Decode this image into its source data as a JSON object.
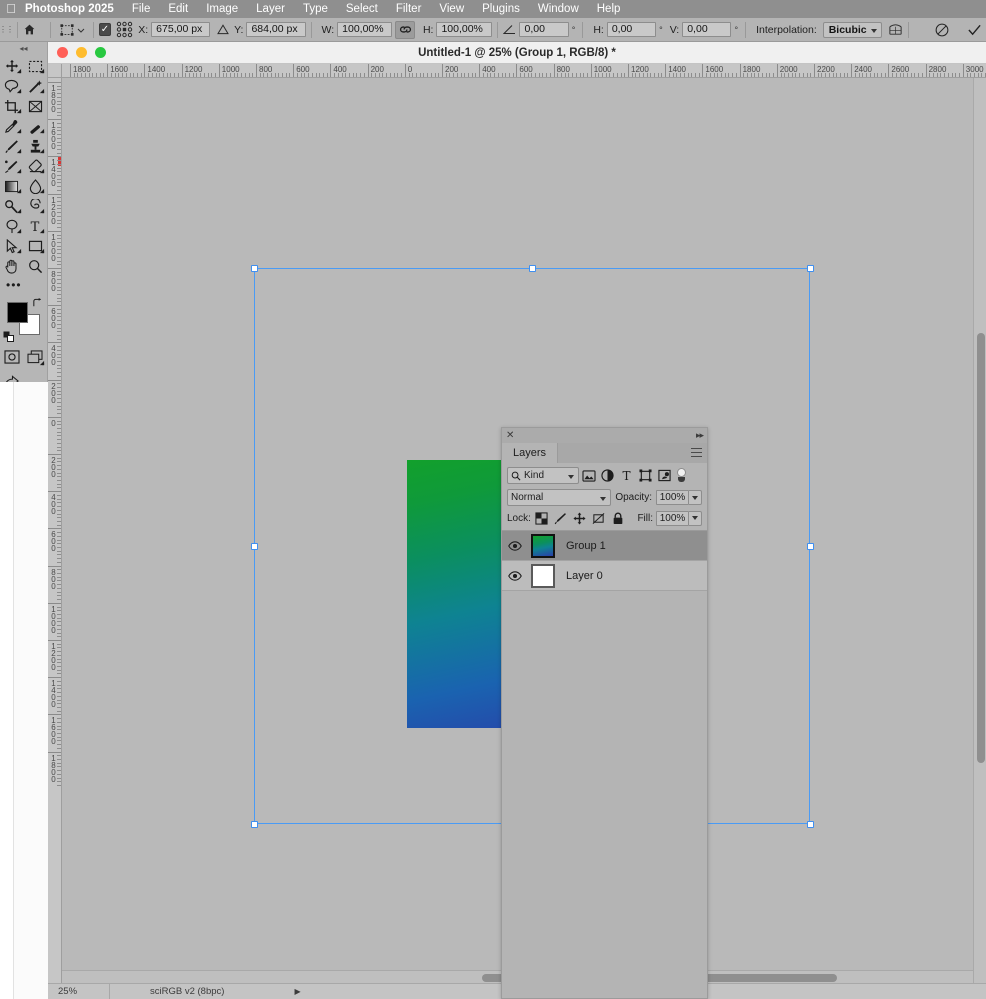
{
  "app": {
    "name": "Photoshop 2025",
    "menus": [
      "File",
      "Edit",
      "Image",
      "Layer",
      "Type",
      "Select",
      "Filter",
      "View",
      "Plugins",
      "Window",
      "Help"
    ]
  },
  "options_bar": {
    "home_icon": "home-icon",
    "tool_preset_icon": "transform-tool-icon",
    "reference_point_icon": "reference-point-grid-icon",
    "show_transform_checkbox": true,
    "x_label": "X:",
    "x_value": "675,00 px",
    "delta_icon": "delta-triangle-icon",
    "y_label": "Y:",
    "y_value": "684,00 px",
    "w_label": "W:",
    "w_value": "100,00%",
    "link_icon": "chain-link-icon",
    "h_label": "H:",
    "h_value": "100,00%",
    "angle_icon": "rotate-angle-icon",
    "angle_value": "0,00",
    "angle_unit": "°",
    "skew_h_label": "H:",
    "skew_h_value": "0,00",
    "skew_h_unit": "°",
    "skew_v_label": "V:",
    "skew_v_value": "0,00",
    "skew_v_unit": "°",
    "interpolation_label": "Interpolation:",
    "interpolation_value": "Bicubic",
    "warp_icon": "warp-mode-icon",
    "cancel_icon": "cancel-transform-icon",
    "commit_icon": "commit-transform-icon"
  },
  "tools": [
    {
      "name": "move-tool",
      "icon": "move-arrows-icon",
      "has_corner": true
    },
    {
      "name": "rectangular-marquee-tool",
      "icon": "marquee-dashed-rect-icon",
      "has_corner": true
    },
    {
      "name": "lasso-tool",
      "icon": "lasso-icon",
      "has_corner": true
    },
    {
      "name": "magic-wand-tool",
      "icon": "magic-wand-icon",
      "has_corner": true
    },
    {
      "name": "crop-tool",
      "icon": "crop-icon",
      "has_corner": true
    },
    {
      "name": "frame-tool",
      "icon": "frame-icon",
      "has_corner": false
    },
    {
      "name": "eyedropper-tool",
      "icon": "eyedropper-icon",
      "has_corner": true
    },
    {
      "name": "spot-healing-brush-tool",
      "icon": "healing-brush-icon",
      "has_corner": true
    },
    {
      "name": "brush-tool",
      "icon": "brush-icon",
      "has_corner": true
    },
    {
      "name": "clone-stamp-tool",
      "icon": "clone-stamp-icon",
      "has_corner": true
    },
    {
      "name": "history-brush-tool",
      "icon": "history-brush-icon",
      "has_corner": true
    },
    {
      "name": "eraser-tool",
      "icon": "eraser-icon",
      "has_corner": true
    },
    {
      "name": "gradient-tool",
      "icon": "gradient-icon",
      "has_corner": true
    },
    {
      "name": "blur-tool",
      "icon": "blur-droplet-icon",
      "has_corner": true
    },
    {
      "name": "dodge-tool",
      "icon": "dodge-icon",
      "has_corner": true
    },
    {
      "name": "pen-tool",
      "icon": "pen-icon",
      "has_corner": true
    },
    {
      "name": "path-selection-tool",
      "icon": "path-select-arrow-icon",
      "has_corner": true
    },
    {
      "name": "type-tool",
      "icon": "type-t-icon",
      "has_corner": true
    },
    {
      "name": "rectangle-tool",
      "icon": "rectangle-shape-icon",
      "has_corner": true
    },
    {
      "name": "hand-tool",
      "icon": "hand-icon",
      "has_corner": false
    },
    {
      "name": "zoom-tool",
      "icon": "magnifier-icon",
      "has_corner": false
    }
  ],
  "tools_more": {
    "name": "edit-toolbar-more",
    "icon": "ellipsis-icon",
    "label": "•••"
  },
  "color_swatches": {
    "foreground": "#000000",
    "background": "#ffffff",
    "swap_icon": "swap-colors-icon",
    "default_icon": "default-colors-icon"
  },
  "tools_bottom": [
    {
      "name": "quick-mask-toggle",
      "icon": "quick-mask-icon"
    },
    {
      "name": "screen-mode-toggle",
      "icon": "screen-mode-icon"
    },
    {
      "name": "share-button",
      "icon": "share-image-icon"
    }
  ],
  "document": {
    "title": "Untitled-1 @ 25% (Group 1, RGB/8) *",
    "traffic_lights": [
      "close-button",
      "minimize-button",
      "maximize-button"
    ],
    "zoom": "25%",
    "color_profile": "sciRGB v2 (8bpc)",
    "rulers": {
      "horizontal_labels": [
        "1800",
        "1600",
        "1400",
        "1200",
        "1000",
        "800",
        "600",
        "400",
        "200",
        "0",
        "200",
        "400",
        "600",
        "800",
        "1000",
        "1200",
        "1400",
        "1600",
        "1800",
        "2000",
        "2200",
        "2400",
        "2600",
        "2800",
        "3000"
      ],
      "vertical_labels": [
        "1800",
        "1600",
        "1400",
        "1200",
        "1000",
        "800",
        "600",
        "400",
        "200",
        "0",
        "200",
        "400",
        "600",
        "800",
        "1000",
        "1200",
        "1400",
        "1600",
        "1800"
      ]
    }
  },
  "layers_panel": {
    "tab_label": "Layers",
    "close_icon": "close-panel-icon",
    "collapse_icon": "collapse-panel-icon",
    "menu_icon": "panel-menu-icon",
    "filter": {
      "search_icon": "search-icon",
      "kind_label": "Kind",
      "filter_icons": [
        {
          "name": "filter-pixel-layers-icon",
          "icon": "image-icon"
        },
        {
          "name": "filter-adjustment-layers-icon",
          "icon": "adjustment-circle-icon"
        },
        {
          "name": "filter-type-layers-icon",
          "icon": "type-t-icon"
        },
        {
          "name": "filter-shape-layers-icon",
          "icon": "shape-square-icon"
        },
        {
          "name": "filter-smart-objects-icon",
          "icon": "smart-object-icon"
        }
      ],
      "toggle_name": "filter-enable-toggle"
    },
    "blend_mode": "Normal",
    "opacity_label": "Opacity:",
    "opacity_value": "100%",
    "lock_label": "Lock:",
    "lock_icons": [
      {
        "name": "lock-transparent-pixels-icon",
        "icon": "checkerboard-icon"
      },
      {
        "name": "lock-image-pixels-icon",
        "icon": "brush-icon"
      },
      {
        "name": "lock-position-icon",
        "icon": "move-arrows-icon"
      },
      {
        "name": "lock-artboard-nesting-icon",
        "icon": "artboard-icon"
      },
      {
        "name": "lock-all-icon",
        "icon": "padlock-icon"
      }
    ],
    "fill_label": "Fill:",
    "fill_value": "100%",
    "layers": [
      {
        "name": "Group 1",
        "visible": true,
        "selected": true,
        "thumb": "gradient"
      },
      {
        "name": "Layer 0",
        "visible": true,
        "selected": false,
        "thumb": "white"
      }
    ]
  },
  "canvas": {
    "gradient_colors": {
      "top_left": "#12a02c",
      "mid": "#0e8392",
      "bottom": "#2a3fa8",
      "top_strip": "#3cc74e"
    },
    "transform_box": {
      "accent": "#4a9bf5",
      "handles": 8
    }
  }
}
